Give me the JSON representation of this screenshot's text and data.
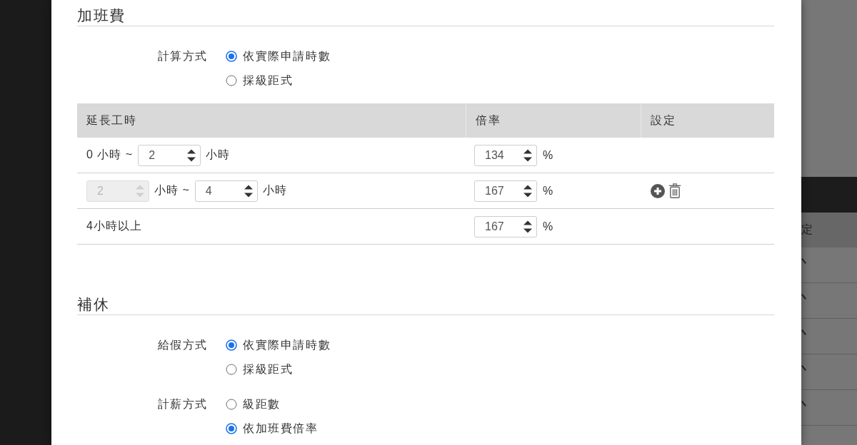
{
  "sections": [
    {
      "title": "加班費",
      "fields": [
        {
          "label": "計算方式",
          "options": [
            {
              "label": "依實際申請時數",
              "selected": true
            },
            {
              "label": "採級距式",
              "selected": false
            }
          ]
        }
      ],
      "table": {
        "columns": [
          "延長工時",
          "倍率",
          "設定"
        ],
        "rows": [
          {
            "range": [
              {
                "kind": "text",
                "text": "0 小時 ~"
              },
              {
                "kind": "number",
                "value": "2",
                "disabled": false
              },
              {
                "kind": "text",
                "text": "小時"
              }
            ],
            "rate": [
              {
                "kind": "number",
                "value": "134",
                "disabled": false
              },
              {
                "kind": "text",
                "text": "%"
              }
            ]
          },
          {
            "range": [
              {
                "kind": "number",
                "value": "2",
                "disabled": true
              },
              {
                "kind": "text",
                "text": "小時 ~"
              },
              {
                "kind": "number",
                "value": "4",
                "disabled": false
              },
              {
                "kind": "text",
                "text": "小時"
              }
            ],
            "rate": [
              {
                "kind": "number",
                "value": "167",
                "disabled": false
              },
              {
                "kind": "text",
                "text": "%"
              }
            ],
            "actions": [
              {
                "kind": "add"
              },
              {
                "kind": "delete"
              }
            ]
          },
          {
            "range": [
              {
                "kind": "text",
                "text": "4小時以上"
              }
            ],
            "rate": [
              {
                "kind": "number",
                "value": "167",
                "disabled": false
              },
              {
                "kind": "text",
                "text": "%"
              }
            ]
          }
        ]
      }
    },
    {
      "title": "補休",
      "fields": [
        {
          "label": "給假方式",
          "options": [
            {
              "label": "依實際申請時數",
              "selected": true
            },
            {
              "label": "採級距式",
              "selected": false
            }
          ]
        },
        {
          "label": "計薪方式",
          "options": [
            {
              "label": "級距數",
              "selected": false
            },
            {
              "label": "依加班費倍率",
              "selected": true
            }
          ]
        }
      ]
    }
  ],
  "background": {
    "column_header": "定",
    "rows": [
      {
        "kind": "edit"
      },
      {
        "kind": "edit"
      },
      {
        "kind": "edit"
      },
      {
        "kind": "edit"
      },
      {
        "kind": "edit"
      }
    ]
  }
}
